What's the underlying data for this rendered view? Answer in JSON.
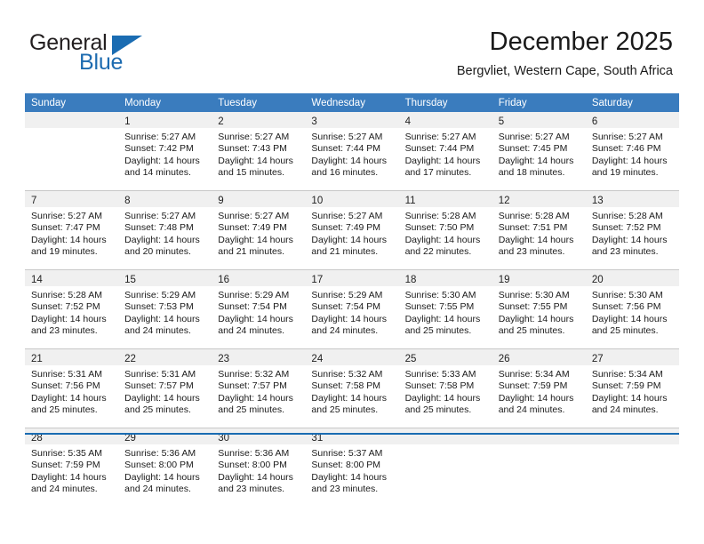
{
  "logo": {
    "word_top": "General",
    "word_bottom": "Blue",
    "triangle_color": "#1a6cb2",
    "blue_color": "#1d6bb0"
  },
  "header": {
    "title": "December 2025",
    "subtitle": "Bergvliet, Western Cape, South Africa"
  },
  "theme": {
    "header_row_bg": "#3a7cbe",
    "daynum_band_bg": "#f0f0f0",
    "rule_color": "#1a6cb2",
    "cell_border": "#c8c8c8"
  },
  "weekdays": [
    "Sunday",
    "Monday",
    "Tuesday",
    "Wednesday",
    "Thursday",
    "Friday",
    "Saturday"
  ],
  "weeks": [
    [
      {
        "day": "",
        "lines": []
      },
      {
        "day": "1",
        "lines": [
          "Sunrise: 5:27 AM",
          "Sunset: 7:42 PM",
          "Daylight: 14 hours",
          "and 14 minutes."
        ]
      },
      {
        "day": "2",
        "lines": [
          "Sunrise: 5:27 AM",
          "Sunset: 7:43 PM",
          "Daylight: 14 hours",
          "and 15 minutes."
        ]
      },
      {
        "day": "3",
        "lines": [
          "Sunrise: 5:27 AM",
          "Sunset: 7:44 PM",
          "Daylight: 14 hours",
          "and 16 minutes."
        ]
      },
      {
        "day": "4",
        "lines": [
          "Sunrise: 5:27 AM",
          "Sunset: 7:44 PM",
          "Daylight: 14 hours",
          "and 17 minutes."
        ]
      },
      {
        "day": "5",
        "lines": [
          "Sunrise: 5:27 AM",
          "Sunset: 7:45 PM",
          "Daylight: 14 hours",
          "and 18 minutes."
        ]
      },
      {
        "day": "6",
        "lines": [
          "Sunrise: 5:27 AM",
          "Sunset: 7:46 PM",
          "Daylight: 14 hours",
          "and 19 minutes."
        ]
      }
    ],
    [
      {
        "day": "7",
        "lines": [
          "Sunrise: 5:27 AM",
          "Sunset: 7:47 PM",
          "Daylight: 14 hours",
          "and 19 minutes."
        ]
      },
      {
        "day": "8",
        "lines": [
          "Sunrise: 5:27 AM",
          "Sunset: 7:48 PM",
          "Daylight: 14 hours",
          "and 20 minutes."
        ]
      },
      {
        "day": "9",
        "lines": [
          "Sunrise: 5:27 AM",
          "Sunset: 7:49 PM",
          "Daylight: 14 hours",
          "and 21 minutes."
        ]
      },
      {
        "day": "10",
        "lines": [
          "Sunrise: 5:27 AM",
          "Sunset: 7:49 PM",
          "Daylight: 14 hours",
          "and 21 minutes."
        ]
      },
      {
        "day": "11",
        "lines": [
          "Sunrise: 5:28 AM",
          "Sunset: 7:50 PM",
          "Daylight: 14 hours",
          "and 22 minutes."
        ]
      },
      {
        "day": "12",
        "lines": [
          "Sunrise: 5:28 AM",
          "Sunset: 7:51 PM",
          "Daylight: 14 hours",
          "and 23 minutes."
        ]
      },
      {
        "day": "13",
        "lines": [
          "Sunrise: 5:28 AM",
          "Sunset: 7:52 PM",
          "Daylight: 14 hours",
          "and 23 minutes."
        ]
      }
    ],
    [
      {
        "day": "14",
        "lines": [
          "Sunrise: 5:28 AM",
          "Sunset: 7:52 PM",
          "Daylight: 14 hours",
          "and 23 minutes."
        ]
      },
      {
        "day": "15",
        "lines": [
          "Sunrise: 5:29 AM",
          "Sunset: 7:53 PM",
          "Daylight: 14 hours",
          "and 24 minutes."
        ]
      },
      {
        "day": "16",
        "lines": [
          "Sunrise: 5:29 AM",
          "Sunset: 7:54 PM",
          "Daylight: 14 hours",
          "and 24 minutes."
        ]
      },
      {
        "day": "17",
        "lines": [
          "Sunrise: 5:29 AM",
          "Sunset: 7:54 PM",
          "Daylight: 14 hours",
          "and 24 minutes."
        ]
      },
      {
        "day": "18",
        "lines": [
          "Sunrise: 5:30 AM",
          "Sunset: 7:55 PM",
          "Daylight: 14 hours",
          "and 25 minutes."
        ]
      },
      {
        "day": "19",
        "lines": [
          "Sunrise: 5:30 AM",
          "Sunset: 7:55 PM",
          "Daylight: 14 hours",
          "and 25 minutes."
        ]
      },
      {
        "day": "20",
        "lines": [
          "Sunrise: 5:30 AM",
          "Sunset: 7:56 PM",
          "Daylight: 14 hours",
          "and 25 minutes."
        ]
      }
    ],
    [
      {
        "day": "21",
        "lines": [
          "Sunrise: 5:31 AM",
          "Sunset: 7:56 PM",
          "Daylight: 14 hours",
          "and 25 minutes."
        ]
      },
      {
        "day": "22",
        "lines": [
          "Sunrise: 5:31 AM",
          "Sunset: 7:57 PM",
          "Daylight: 14 hours",
          "and 25 minutes."
        ]
      },
      {
        "day": "23",
        "lines": [
          "Sunrise: 5:32 AM",
          "Sunset: 7:57 PM",
          "Daylight: 14 hours",
          "and 25 minutes."
        ]
      },
      {
        "day": "24",
        "lines": [
          "Sunrise: 5:32 AM",
          "Sunset: 7:58 PM",
          "Daylight: 14 hours",
          "and 25 minutes."
        ]
      },
      {
        "day": "25",
        "lines": [
          "Sunrise: 5:33 AM",
          "Sunset: 7:58 PM",
          "Daylight: 14 hours",
          "and 25 minutes."
        ]
      },
      {
        "day": "26",
        "lines": [
          "Sunrise: 5:34 AM",
          "Sunset: 7:59 PM",
          "Daylight: 14 hours",
          "and 24 minutes."
        ]
      },
      {
        "day": "27",
        "lines": [
          "Sunrise: 5:34 AM",
          "Sunset: 7:59 PM",
          "Daylight: 14 hours",
          "and 24 minutes."
        ]
      }
    ],
    [
      {
        "day": "28",
        "lines": [
          "Sunrise: 5:35 AM",
          "Sunset: 7:59 PM",
          "Daylight: 14 hours",
          "and 24 minutes."
        ]
      },
      {
        "day": "29",
        "lines": [
          "Sunrise: 5:36 AM",
          "Sunset: 8:00 PM",
          "Daylight: 14 hours",
          "and 24 minutes."
        ]
      },
      {
        "day": "30",
        "lines": [
          "Sunrise: 5:36 AM",
          "Sunset: 8:00 PM",
          "Daylight: 14 hours",
          "and 23 minutes."
        ]
      },
      {
        "day": "31",
        "lines": [
          "Sunrise: 5:37 AM",
          "Sunset: 8:00 PM",
          "Daylight: 14 hours",
          "and 23 minutes."
        ]
      },
      {
        "day": "",
        "lines": []
      },
      {
        "day": "",
        "lines": []
      },
      {
        "day": "",
        "lines": []
      }
    ]
  ]
}
